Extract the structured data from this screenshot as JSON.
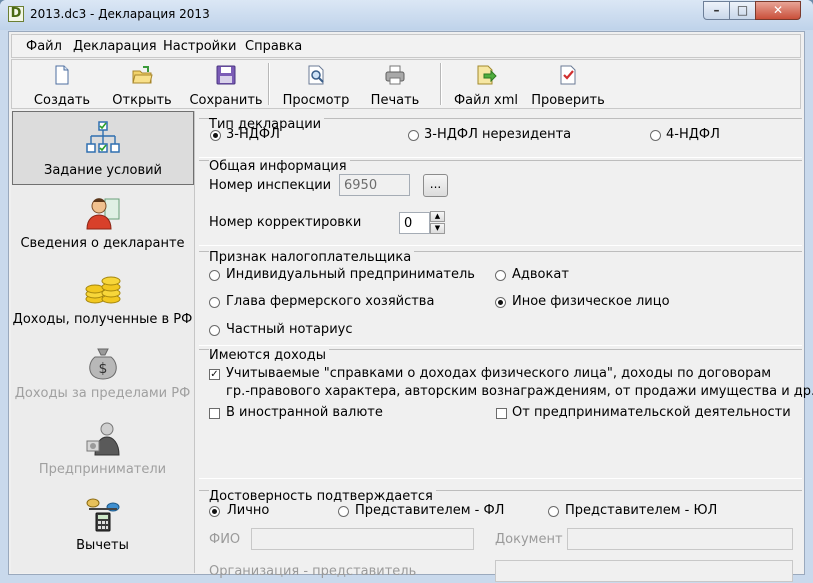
{
  "window": {
    "title": "2013.dc3 - Декларация 2013",
    "icon_letter": "D",
    "controls": {
      "minimize": "–",
      "maximize": "□",
      "close": "✕"
    }
  },
  "menu": [
    "Файл",
    "Декларация",
    "Настройки",
    "Справка"
  ],
  "toolbar": {
    "create": "Создать",
    "open": "Открыть",
    "save": "Сохранить",
    "preview": "Просмотр",
    "print": "Печать",
    "export_xml": "Файл xml",
    "check": "Проверить"
  },
  "sidebar": [
    {
      "label": "Задание условий",
      "icon": "conditions-tree-icon",
      "selected": true,
      "enabled": true
    },
    {
      "label": "Сведения о декларанте",
      "icon": "person-document-icon",
      "selected": false,
      "enabled": true
    },
    {
      "label": "Доходы, полученные в РФ",
      "icon": "coins-icon",
      "selected": false,
      "enabled": true
    },
    {
      "label": "Доходы за пределами РФ",
      "icon": "money-bag-icon",
      "selected": false,
      "enabled": false
    },
    {
      "label": "Предприниматели",
      "icon": "businessman-icon",
      "selected": false,
      "enabled": false
    },
    {
      "label": "Вычеты",
      "icon": "scales-calculator-icon",
      "selected": false,
      "enabled": true
    }
  ],
  "declaration_type": {
    "title": "Тип декларации",
    "options": [
      "3-НДФЛ",
      "3-НДФЛ нерезидента",
      "4-НДФЛ"
    ],
    "selected": "3-НДФЛ"
  },
  "general": {
    "title": "Общая информация",
    "inspection_label": "Номер инспекции",
    "inspection_value": "6950",
    "browse_button": "...",
    "correction_label": "Номер корректировки",
    "correction_value": "0"
  },
  "taxpayer": {
    "title": "Признак налогоплательщика",
    "options": [
      "Индивидуальный предприниматель",
      "Адвокат",
      "Глава фермерского хозяйства",
      "Иное физическое лицо",
      "Частный нотариус"
    ],
    "selected": "Иное физическое лицо"
  },
  "incomes": {
    "title": "Имеются доходы",
    "certified_line1": "Учитываемые \"справками о доходах физического лица\", доходы по договорам",
    "certified_line2": "гр.-правового характера, авторским вознаграждениям, от продажи имущества и др.",
    "certified_checked": true,
    "foreign_currency": "В иностранной валюте",
    "foreign_currency_checked": false,
    "entrepreneurial": "От предпринимательской деятельности",
    "entrepreneurial_checked": false
  },
  "confirmation": {
    "title": "Достоверность подтверждается",
    "options": [
      "Лично",
      "Представителем - ФЛ",
      "Представителем - ЮЛ"
    ],
    "selected": "Лично",
    "fio_label": "ФИО",
    "fio_value": "",
    "document_label": "Документ",
    "document_value": "",
    "org_label": "Организация - представитель",
    "org_value": ""
  }
}
